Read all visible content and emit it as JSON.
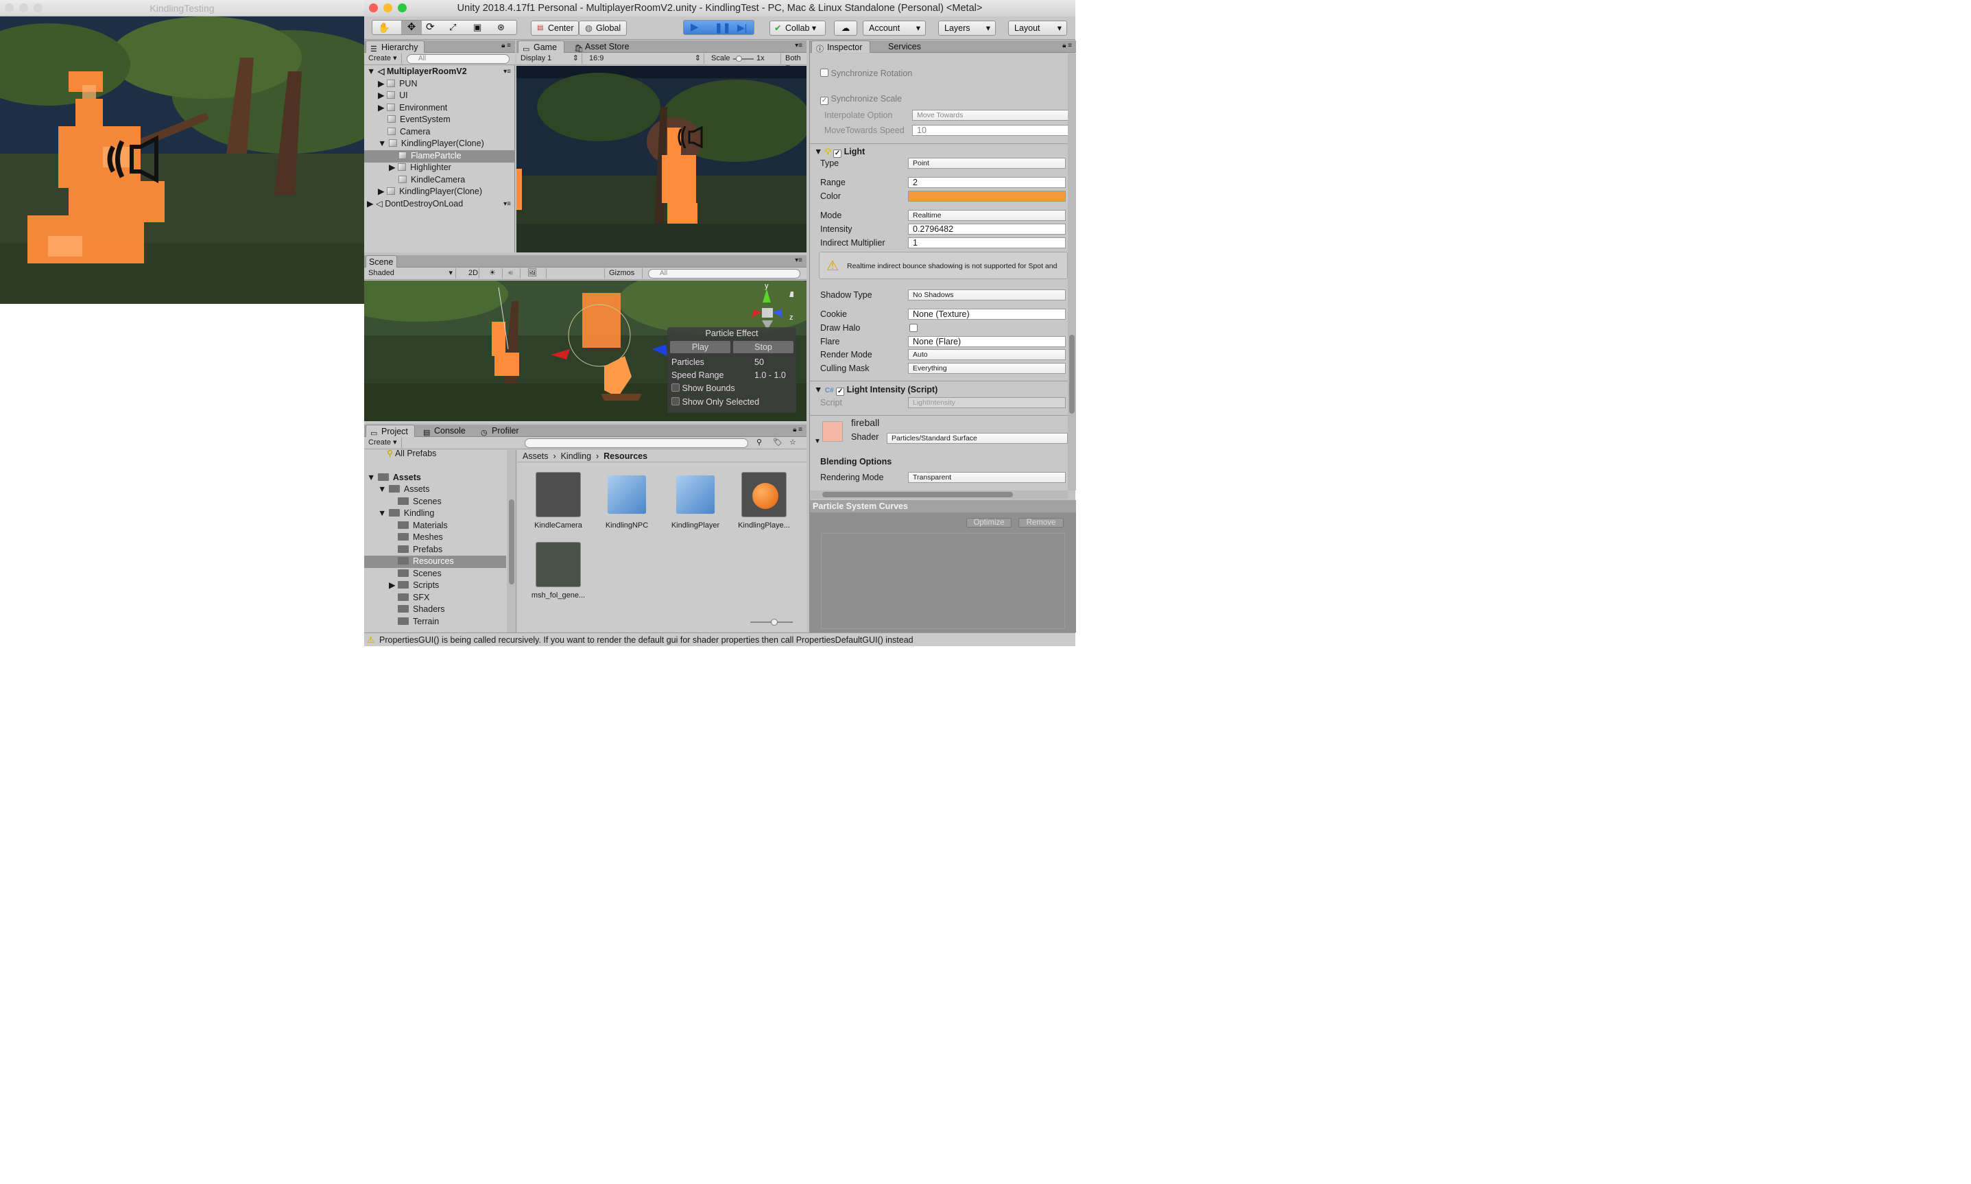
{
  "game_window": {
    "title": "KindlingTesting"
  },
  "unity": {
    "title": "Unity 2018.4.17f1 Personal - MultiplayerRoomV2.unity - KindlingTest - PC, Mac & Linux Standalone (Personal) <Metal>",
    "toolbar": {
      "pivot": "Center",
      "space": "Global",
      "collab": "Collab",
      "account": "Account",
      "layers": "Layers",
      "layout": "Layout"
    },
    "hierarchy": {
      "tab": "Hierarchy",
      "create": "Create",
      "search_placeholder": "All",
      "scene": "MultiplayerRoomV2",
      "items": [
        "PUN",
        "UI",
        "Environment",
        "EventSystem",
        "Camera",
        "KindlingPlayer(Clone)",
        "FlamePartcle",
        "Highlighter",
        "KindleCamera",
        "KindlingPlayer(Clone)"
      ],
      "dont_destroy": "DontDestroyOnLoad"
    },
    "game": {
      "tab": "Game",
      "asset_tab": "Asset Store",
      "display": "Display 1",
      "aspect": "16:9",
      "scale_label": "Scale",
      "scale_value": "1x",
      "both": "Both E"
    },
    "scene": {
      "tab": "Scene",
      "shading": "Shaded",
      "mode2d": "2D",
      "gizmos": "Gizmos",
      "search_placeholder": "All",
      "axes": {
        "y": "y",
        "z": "z"
      },
      "particle_effect": {
        "title": "Particle Effect",
        "play": "Play",
        "stop": "Stop",
        "particles_label": "Particles",
        "particles_value": "50",
        "speed_label": "Speed Range",
        "speed_value": "1.0 - 1.0",
        "show_bounds": "Show Bounds",
        "show_only_selected": "Show Only Selected"
      }
    },
    "inspector": {
      "tab": "Inspector",
      "services_tab": "Services",
      "sync_rotation": "Synchronize Rotation",
      "sync_scale": "Synchronize Scale",
      "interp_label": "Interpolate Option",
      "interp_value": "Move Towards",
      "movetowards_label": "MoveTowards Speed",
      "movetowards_value": "10",
      "light_header": "Light",
      "props": [
        {
          "label": "Type",
          "value": "Point"
        },
        {
          "label": "Range",
          "value": "2"
        },
        {
          "label": "Color",
          "value": ""
        },
        {
          "label": "Mode",
          "value": "Realtime"
        },
        {
          "label": "Intensity",
          "value": "0.2796482"
        },
        {
          "label": "Indirect Multiplier",
          "value": "1"
        }
      ],
      "warning": "Realtime indirect bounce shadowing is not supported for Spot and",
      "props2": [
        {
          "label": "Shadow Type",
          "value": "No Shadows"
        },
        {
          "label": "Cookie",
          "value": "None (Texture)"
        },
        {
          "label": "Draw Halo",
          "value": ""
        },
        {
          "label": "Flare",
          "value": "None (Flare)"
        },
        {
          "label": "Render Mode",
          "value": "Auto"
        },
        {
          "label": "Culling Mask",
          "value": "Everything"
        }
      ],
      "script_header": "Light Intensity (Script)",
      "script_label": "Script",
      "script_value": "LightIntensity",
      "material_name": "fireball",
      "shader_label": "Shader",
      "shader_value": "Particles/Standard Surface",
      "blending": "Blending Options",
      "rendering_label": "Rendering Mode",
      "rendering_value": "Transparent",
      "curves_title": "Particle System Curves",
      "optimize": "Optimize",
      "remove": "Remove",
      "light_color": "#f59a3a"
    },
    "project": {
      "tab": "Project",
      "console_tab": "Console",
      "profiler_tab": "Profiler",
      "create": "Create",
      "tree": [
        {
          "label": "All Prefabs",
          "indent": 0
        },
        {
          "label": "Assets",
          "indent": 0,
          "bold": true
        },
        {
          "label": "Assets",
          "indent": 1
        },
        {
          "label": "Scenes",
          "indent": 2
        },
        {
          "label": "Kindling",
          "indent": 1
        },
        {
          "label": "Materials",
          "indent": 2
        },
        {
          "label": "Meshes",
          "indent": 2
        },
        {
          "label": "Prefabs",
          "indent": 2
        },
        {
          "label": "Resources",
          "indent": 2
        },
        {
          "label": "Scenes",
          "indent": 2
        },
        {
          "label": "Scripts",
          "indent": 2
        },
        {
          "label": "SFX",
          "indent": 2
        },
        {
          "label": "Shaders",
          "indent": 2
        },
        {
          "label": "Terrain",
          "indent": 2
        }
      ],
      "breadcrumb": [
        "Assets",
        "Kindling",
        "Resources"
      ],
      "assets": [
        "KindleCamera",
        "KindlingNPC",
        "KindlingPlayer",
        "KindlingPlaye...",
        "msh_fol_gene..."
      ]
    },
    "status": "PropertiesGUI() is being called recursively. If you want to render the default gui for shader properties then call PropertiesDefaultGUI() instead"
  }
}
